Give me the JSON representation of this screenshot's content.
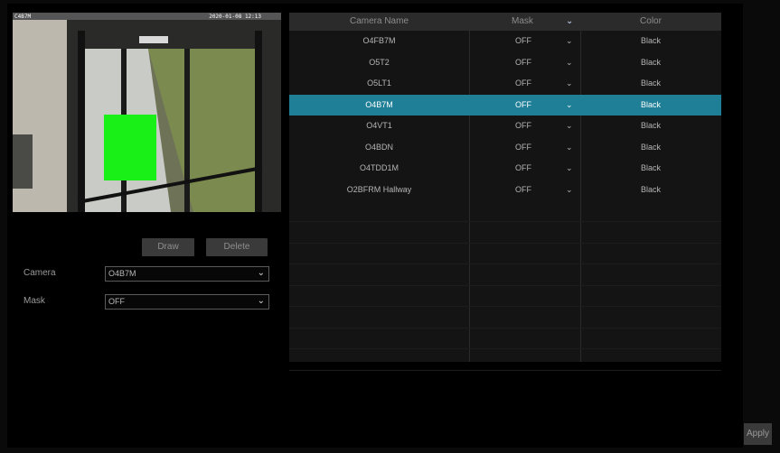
{
  "preview": {
    "camera_label": "C4B7M",
    "timestamp": "2020-01-08 12:13"
  },
  "buttons": {
    "draw": "Draw",
    "delete": "Delete",
    "apply": "Apply"
  },
  "form": {
    "camera_label": "Camera",
    "camera_value": "O4B7M",
    "mask_label": "Mask",
    "mask_value": "OFF"
  },
  "table": {
    "headers": {
      "name": "Camera Name",
      "mask": "Mask",
      "color": "Color"
    },
    "rows": [
      {
        "name": "O4FB7M",
        "mask": "OFF",
        "color": "Black"
      },
      {
        "name": "O5T2",
        "mask": "OFF",
        "color": "Black"
      },
      {
        "name": "O5LT1",
        "mask": "OFF",
        "color": "Black"
      },
      {
        "name": "O4B7M",
        "mask": "OFF",
        "color": "Black"
      },
      {
        "name": "O4VT1",
        "mask": "OFF",
        "color": "Black"
      },
      {
        "name": "O4BDN",
        "mask": "OFF",
        "color": "Black"
      },
      {
        "name": "O4TDD1M",
        "mask": "OFF",
        "color": "Black"
      },
      {
        "name": "O2BFRM Hallway",
        "mask": "OFF",
        "color": "Black"
      }
    ],
    "selected_index": 3
  },
  "colors": {
    "accent": "#1e7f96",
    "mask_region": "#18f018"
  }
}
